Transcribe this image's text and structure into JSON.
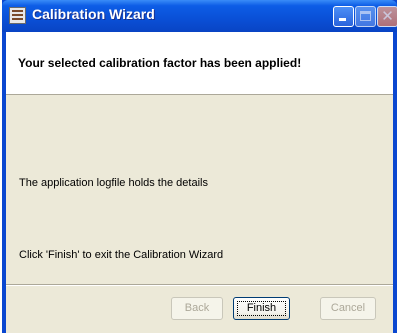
{
  "window": {
    "title": "Calibration Wizard",
    "icon": "calibration-app-icon",
    "controls": {
      "minimize_icon": "minimize-icon",
      "maximize_icon": "maximize-icon",
      "close_icon": "close-icon",
      "close_glyph": "✕"
    }
  },
  "header": {
    "title": "Your selected calibration factor has been applied!"
  },
  "body": {
    "line1": "The application logfile holds the details",
    "line2": "Click 'Finish' to exit the Calibration Wizard"
  },
  "buttons": {
    "back": {
      "label": "Back",
      "enabled": false
    },
    "finish": {
      "label": "Finish",
      "enabled": true,
      "focused": true
    },
    "cancel": {
      "label": "Cancel",
      "enabled": false
    }
  },
  "colors": {
    "titlebar": "#0a4fd6",
    "dialog_face": "#ece9d8",
    "header_background": "#ffffff",
    "disabled_text": "#aca899"
  }
}
